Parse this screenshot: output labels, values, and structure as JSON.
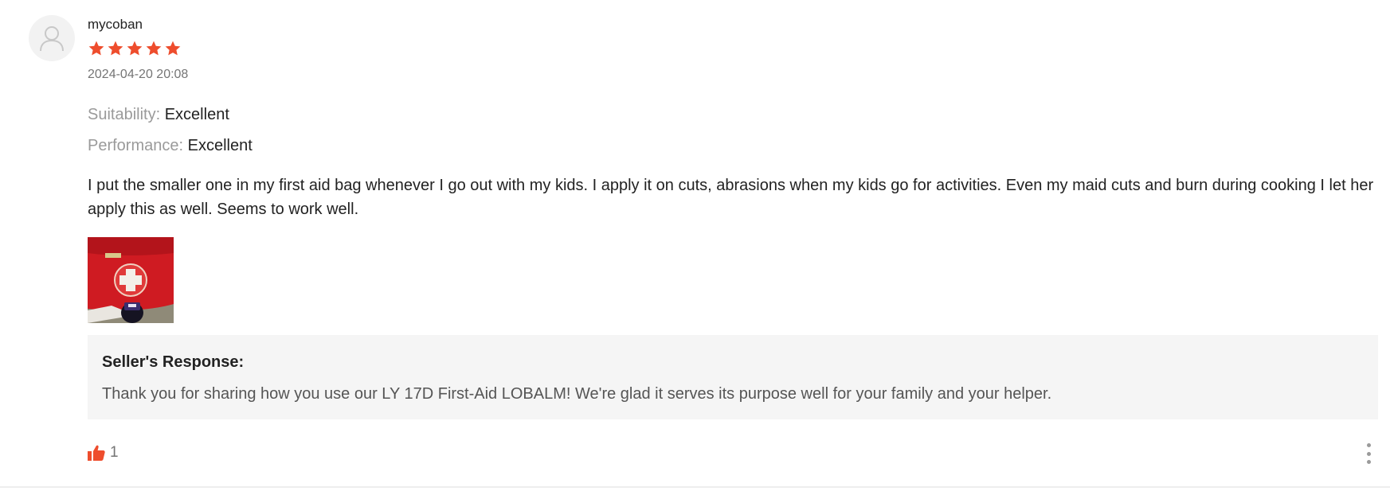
{
  "review": {
    "username": "mycoban",
    "rating": 5,
    "rating_max": 5,
    "timestamp": "2024-04-20 20:08",
    "attributes": [
      {
        "label": "Suitability:",
        "value": "Excellent"
      },
      {
        "label": "Performance:",
        "value": "Excellent"
      }
    ],
    "text": "I put the smaller one in my first aid bag whenever I go out with my kids. I apply it on cuts, abrasions when my kids go for activities. Even my maid cuts and burn during cooking I let her apply this as well. Seems to work well.",
    "photo_icon": "review-photo-first-aid-bag"
  },
  "seller_response": {
    "title": "Seller's Response:",
    "text": "Thank you for sharing how you use our LY 17D First-Aid LOBALM! We're glad it serves its purpose well for your family and your helper."
  },
  "actions": {
    "like_count": "1",
    "like_icon": "thumbs-up-icon",
    "more_icon": "more-vertical-icon"
  },
  "colors": {
    "accent": "#ee4d2d",
    "response_bg": "#f5f5f5",
    "muted_text": "#757575"
  }
}
